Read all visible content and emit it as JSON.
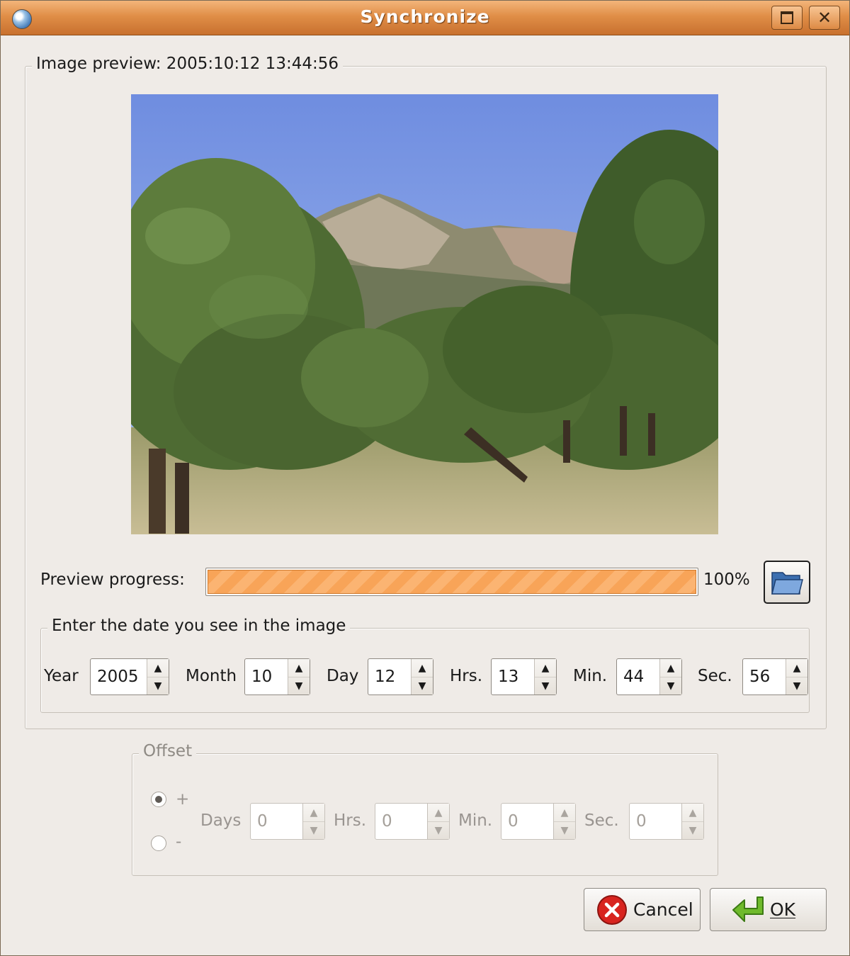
{
  "window": {
    "title": "Synchronize",
    "icon": "globe-icon",
    "controls": [
      "maximize-icon",
      "close-icon"
    ]
  },
  "preview": {
    "label": "Image preview: 2005:10:12 13:44:56",
    "progress_label": "Preview progress:",
    "progress_value": 1.0,
    "progress_text": "100%",
    "open_button_icon": "folder-open-icon",
    "progress_color": "#f8a458"
  },
  "date": {
    "label": "Enter the date you see in the image",
    "fields": [
      {
        "label": "Year",
        "value": "2005"
      },
      {
        "label": "Month",
        "value": "10"
      },
      {
        "label": "Day",
        "value": "12"
      },
      {
        "label": "Hrs.",
        "value": "13"
      },
      {
        "label": "Min.",
        "value": "44"
      },
      {
        "label": "Sec.",
        "value": "56"
      }
    ]
  },
  "offset": {
    "label": "Offset",
    "sign_plus": "+",
    "sign_minus": "-",
    "selected_sign": "+",
    "fields": [
      {
        "label": "Days",
        "value": "0"
      },
      {
        "label": "Hrs.",
        "value": "0"
      },
      {
        "label": "Min.",
        "value": "0"
      },
      {
        "label": "Sec.",
        "value": "0"
      }
    ]
  },
  "buttons": {
    "cancel": "Cancel",
    "ok": "OK",
    "cancel_icon": "cancel-circle-icon",
    "ok_icon": "enter-arrow-icon"
  }
}
